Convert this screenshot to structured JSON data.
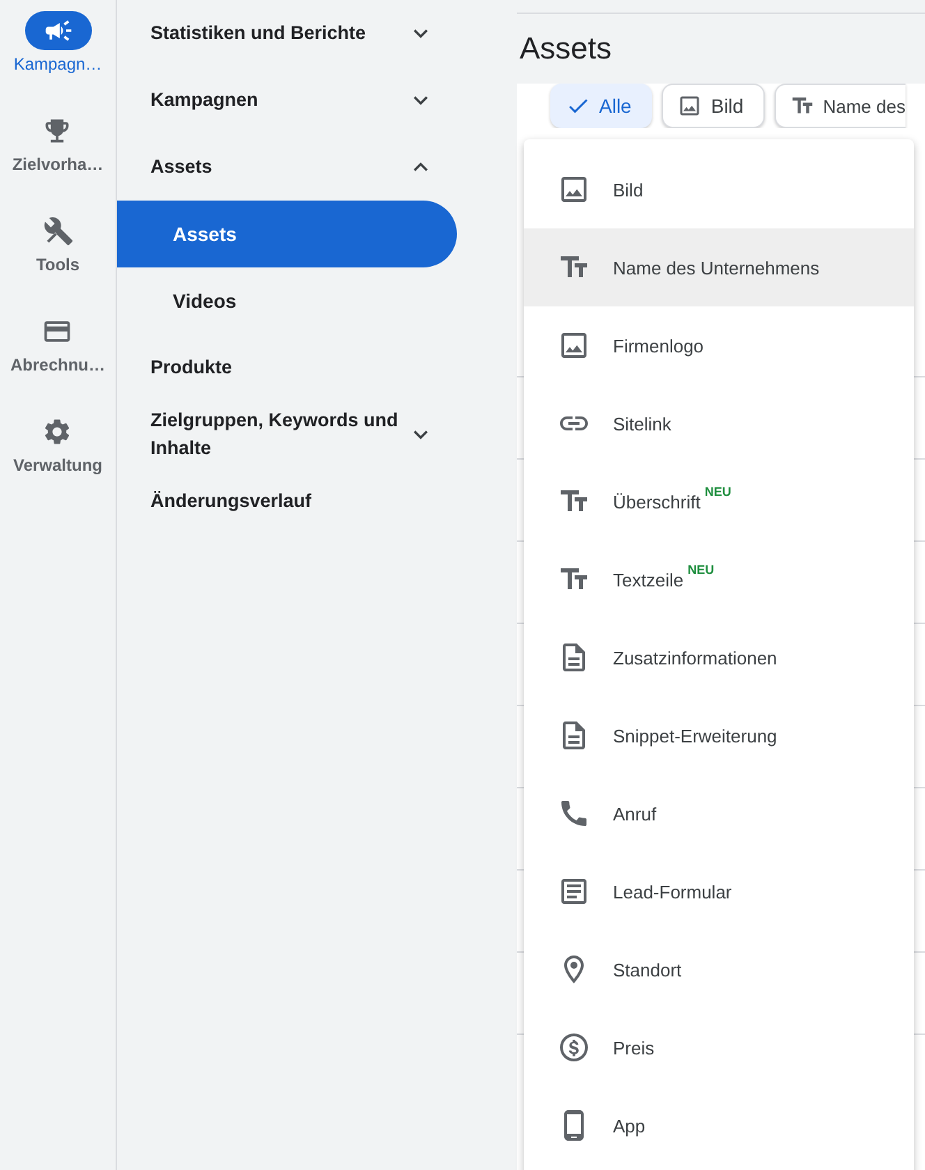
{
  "rail": [
    {
      "kind": "campaign",
      "label": "Kampagn…",
      "selected": true
    },
    {
      "kind": "trophy",
      "label": "Zielvorha…",
      "selected": false
    },
    {
      "kind": "tools",
      "label": "Tools",
      "selected": false
    },
    {
      "kind": "card",
      "label": "Abrechnu…",
      "selected": false
    },
    {
      "kind": "gear",
      "label": "Verwaltung",
      "selected": false
    }
  ],
  "nav": [
    {
      "label": "Statistiken und Berichte",
      "expanded": false
    },
    {
      "label": "Kampagnen",
      "expanded": false
    },
    {
      "label": "Assets",
      "expanded": true,
      "children": [
        {
          "label": "Assets",
          "selected": true
        },
        {
          "label": "Videos",
          "selected": false
        }
      ]
    },
    {
      "label": "Produkte"
    },
    {
      "label": "Zielgruppen, Keywords und Inhalte",
      "expanded": false
    },
    {
      "label": "Änderungsverlauf"
    }
  ],
  "page_title": "Assets",
  "chips": [
    {
      "kind": "check",
      "label": "Alle",
      "selected": true
    },
    {
      "kind": "image",
      "label": "Bild",
      "selected": false
    },
    {
      "kind": "text",
      "label": "Name des",
      "selected": false
    }
  ],
  "menu": [
    {
      "kind": "image",
      "label": "Bild",
      "highlighted": false
    },
    {
      "kind": "text",
      "label": "Name des Unternehmens",
      "highlighted": true
    },
    {
      "kind": "image",
      "label": "Firmenlogo",
      "highlighted": false
    },
    {
      "kind": "link",
      "label": "Sitelink",
      "highlighted": false
    },
    {
      "kind": "text",
      "label": "Überschrift",
      "badge": "NEU",
      "highlighted": false
    },
    {
      "kind": "text",
      "label": "Textzeile",
      "badge": "NEU",
      "highlighted": false
    },
    {
      "kind": "doc",
      "label": "Zusatzinformationen",
      "highlighted": false
    },
    {
      "kind": "doc",
      "label": "Snippet-Erweiterung",
      "highlighted": false
    },
    {
      "kind": "phone",
      "label": "Anruf",
      "highlighted": false
    },
    {
      "kind": "form",
      "label": "Lead-Formular",
      "highlighted": false
    },
    {
      "kind": "pin",
      "label": "Standort",
      "highlighted": false
    },
    {
      "kind": "price",
      "label": "Preis",
      "highlighted": false
    },
    {
      "kind": "app",
      "label": "App",
      "highlighted": false
    }
  ]
}
